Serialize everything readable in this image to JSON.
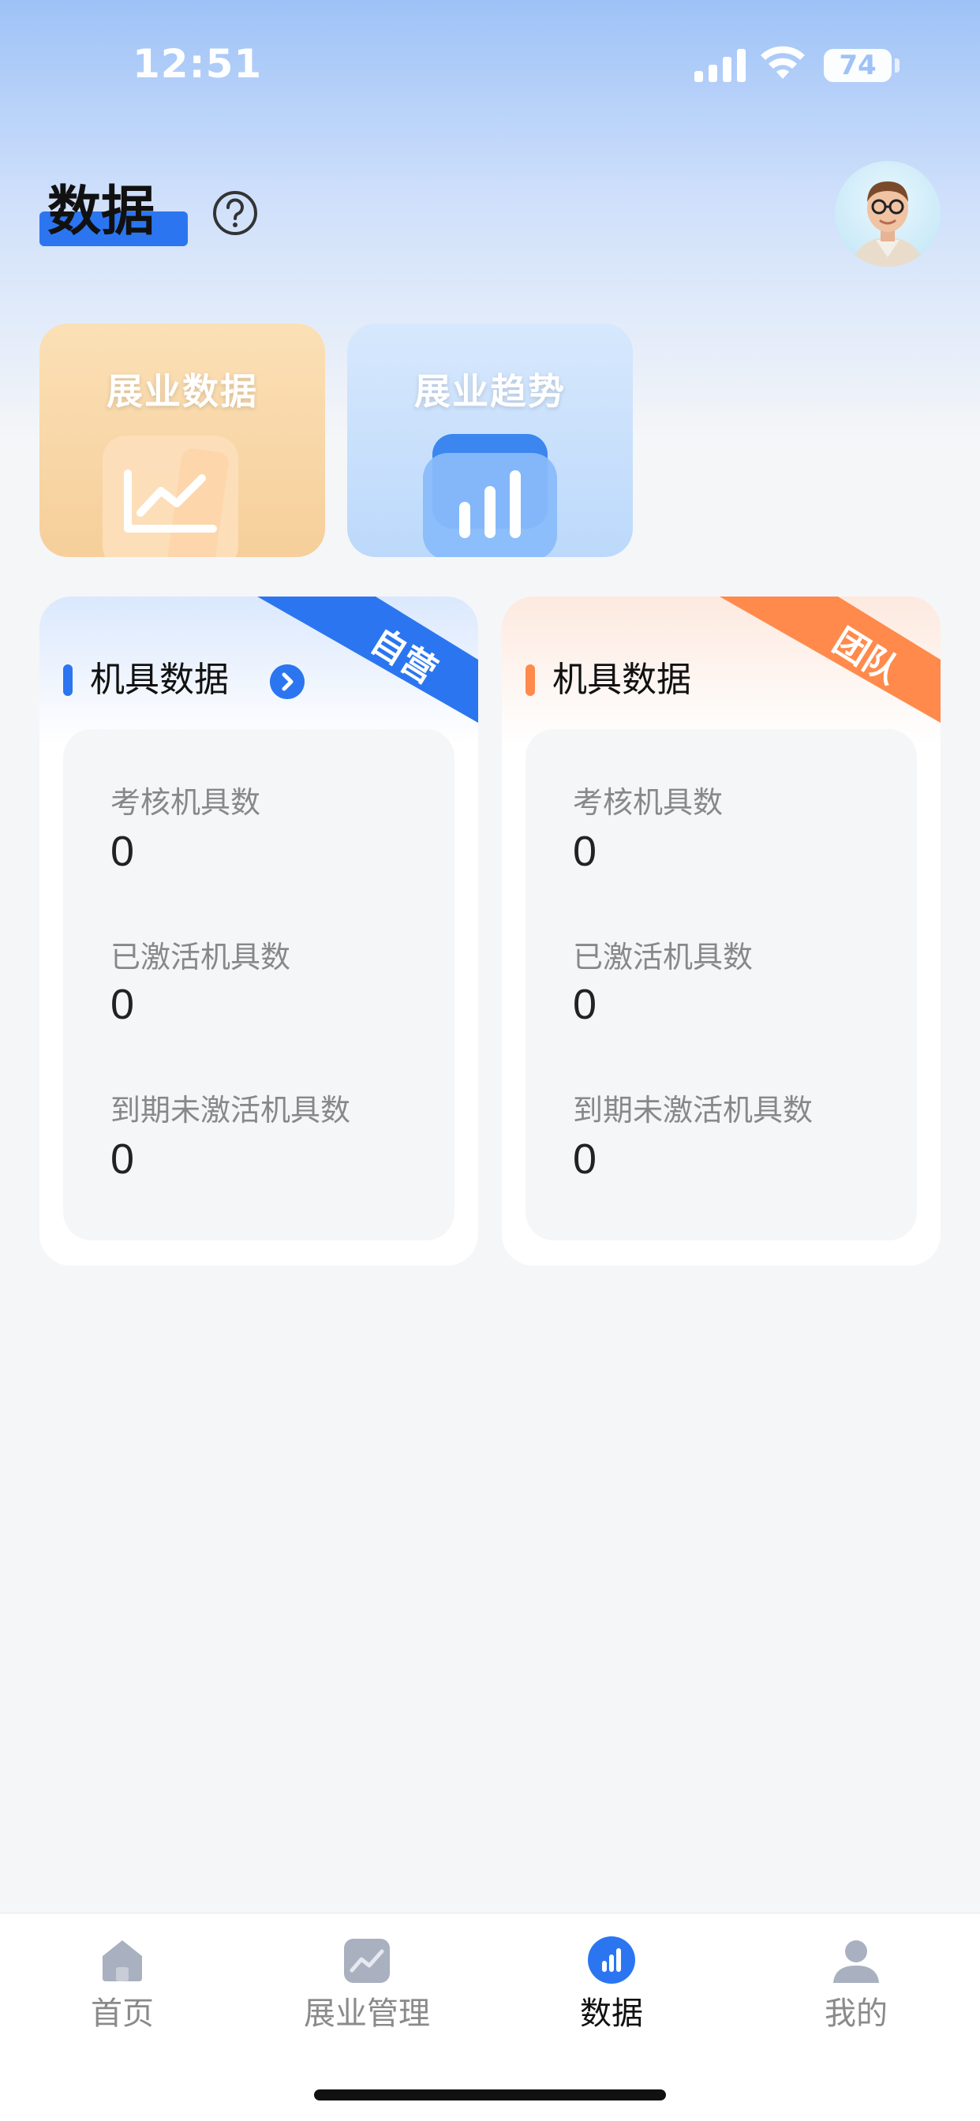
{
  "status_bar": {
    "time": "12:51",
    "battery": "74",
    "icons": [
      "signal-icon",
      "wifi-icon",
      "battery-icon"
    ]
  },
  "header": {
    "title": "数据",
    "help_icon": "question-circle-icon",
    "avatar": "avatar"
  },
  "entries": [
    {
      "label": "展业数据",
      "icon": "line-chart-icon",
      "color": "#f6cf9a"
    },
    {
      "label": "展业趋势",
      "icon": "bar-chart-icon",
      "color": "#bcd9fb"
    }
  ],
  "cards": [
    {
      "title": "机具数据",
      "ribbon": "自营",
      "accent": "#2b76f0",
      "metrics": [
        {
          "label": "考核机具数",
          "value": "0"
        },
        {
          "label": "已激活机具数",
          "value": "0"
        },
        {
          "label": "到期未激活机具数",
          "value": "0"
        }
      ]
    },
    {
      "title": "机具数据",
      "ribbon": "团队",
      "accent": "#ff8a4c",
      "metrics": [
        {
          "label": "考核机具数",
          "value": "0"
        },
        {
          "label": "已激活机具数",
          "value": "0"
        },
        {
          "label": "到期未激活机具数",
          "value": "0"
        }
      ]
    }
  ],
  "tabs": [
    {
      "label": "首页",
      "icon": "home-icon",
      "active": false
    },
    {
      "label": "展业管理",
      "icon": "trend-icon",
      "active": false
    },
    {
      "label": "数据",
      "icon": "data-icon",
      "active": true
    },
    {
      "label": "我的",
      "icon": "user-icon",
      "active": false
    }
  ],
  "colors": {
    "primary": "#2b76f0",
    "team": "#ff8a4c",
    "background": "#f5f6f8"
  }
}
